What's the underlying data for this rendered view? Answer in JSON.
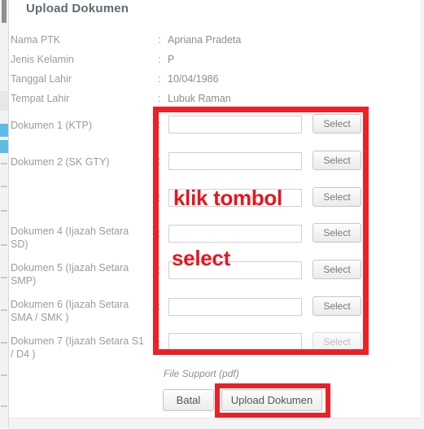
{
  "modal": {
    "title": "Upload Dokumen"
  },
  "info_rows": [
    {
      "label": "Nama PTK",
      "colon": ":",
      "value": "Apriana Pradeta"
    },
    {
      "label": "Jenis Kelamin",
      "colon": ":",
      "value": "P"
    },
    {
      "label": "Tanggal Lahir",
      "colon": ":",
      "value": "10/04/1986"
    },
    {
      "label": "Tempat Lahir",
      "colon": ":",
      "value": "Lubuk Raman"
    }
  ],
  "documents": [
    {
      "label": "Dokumen 1 (KTP)",
      "colon": ":",
      "value": "",
      "placeholder": "",
      "select_label": "Select",
      "disabled": false
    },
    {
      "label": "Dokumen 2 (SK GTY)",
      "colon": ":",
      "value": "",
      "placeholder": "",
      "select_label": "Select",
      "disabled": false
    },
    {
      "label": "",
      "colon": ":",
      "value": "",
      "placeholder": "",
      "select_label": "Select",
      "disabled": false
    },
    {
      "label": "Dokumen 4 (Ijazah Setara SD)",
      "colon": ":",
      "value": "",
      "placeholder": "",
      "select_label": "Select",
      "disabled": false
    },
    {
      "label": "Dokumen 5 (Ijazah Setara SMP)",
      "colon": ":",
      "value": "",
      "placeholder": "",
      "select_label": "Select",
      "disabled": false
    },
    {
      "label": "Dokumen 6 (Ijazah Setara SMA / SMK )",
      "colon": ":",
      "value": "",
      "placeholder": "",
      "select_label": "Select",
      "disabled": false
    },
    {
      "label": "Dokumen 7 (Ijazah Setara S1 / D4 )",
      "colon": ":",
      "value": "",
      "placeholder": "",
      "select_label": "Select",
      "disabled": true
    }
  ],
  "annotations": {
    "line1": "klik tombol",
    "line2": "select",
    "color": "#e8151f"
  },
  "footer": {
    "file_support": "File Support (pdf)",
    "cancel_label": "Batal",
    "upload_label": "Upload Dokumen"
  },
  "highlight": {
    "color": "#ec2027"
  }
}
